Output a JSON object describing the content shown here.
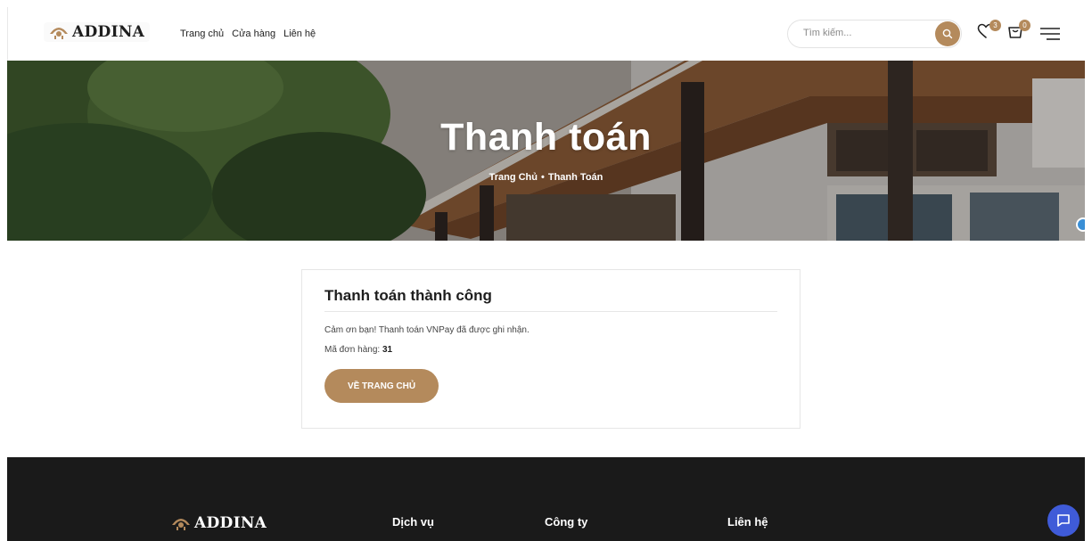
{
  "brand": {
    "name": "ADDINA",
    "accent": "#b48a5c"
  },
  "nav": {
    "items": [
      "Trang chủ",
      "Cửa hàng",
      "Liên hệ"
    ]
  },
  "search": {
    "placeholder": "Tìm kiếm...",
    "value": ""
  },
  "header_icons": {
    "wishlist": {
      "icon": "heart-icon",
      "count": "3"
    },
    "cart": {
      "icon": "cart-icon",
      "count": "0"
    },
    "menu": {
      "icon": "menu-icon"
    }
  },
  "hero": {
    "title": "Thanh toán",
    "breadcrumb": [
      "Trang Chủ",
      "Thanh Toán"
    ]
  },
  "result": {
    "title": "Thanh toán thành công",
    "message": "Cảm ơn bạn! Thanh toán VNPay đã được ghi nhận.",
    "order_label": "Mã đơn hàng:",
    "order_id": "31",
    "button_label": "VỀ TRANG CHỦ"
  },
  "footer": {
    "brand": "ADDINA",
    "columns": [
      "Dịch vụ",
      "Công ty",
      "Liên hệ"
    ]
  }
}
